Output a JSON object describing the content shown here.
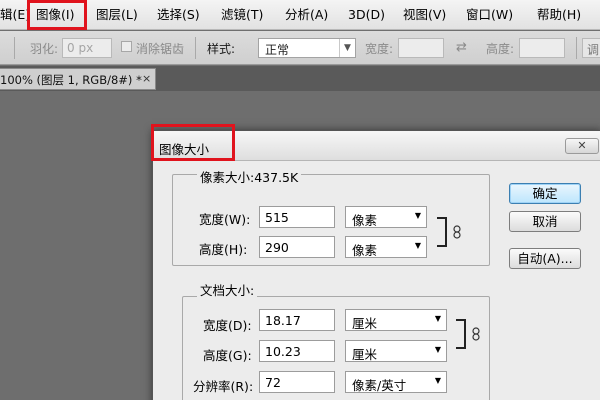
{
  "menu": {
    "items": [
      {
        "label": "辑(E)"
      },
      {
        "label": "图像(I)"
      },
      {
        "label": "图层(L)"
      },
      {
        "label": "选择(S)"
      },
      {
        "label": "滤镜(T)"
      },
      {
        "label": "分析(A)"
      },
      {
        "label": "3D(D)"
      },
      {
        "label": "视图(V)"
      },
      {
        "label": "窗口(W)"
      },
      {
        "label": "帮助(H)"
      }
    ]
  },
  "options_bar": {
    "feather_label": "羽化:",
    "feather_value": "0 px",
    "antialias_label": "消除锯齿",
    "style_label": "样式:",
    "style_value": "正常",
    "width_label": "宽度:",
    "height_label": "高度:",
    "refine_label": "调"
  },
  "document_tab": {
    "label": "100% (图层 1, RGB/8#) *",
    "close": "×"
  },
  "dialog": {
    "title": "图像大小",
    "close": "✕",
    "pixel_dimensions": {
      "label": "像素大小:437.5K",
      "width_label": "宽度(W):",
      "width_value": "515",
      "width_unit": "像素",
      "height_label": "高度(H):",
      "height_value": "290",
      "height_unit": "像素"
    },
    "document_size": {
      "label": "文档大小:",
      "width_label": "宽度(D):",
      "width_value": "18.17",
      "width_unit": "厘米",
      "height_label": "高度(G):",
      "height_value": "10.23",
      "height_unit": "厘米",
      "resolution_label": "分辨率(R):",
      "resolution_value": "72",
      "resolution_unit": "像素/英寸"
    },
    "buttons": {
      "ok": "确定",
      "cancel": "取消",
      "auto": "自动(A)..."
    }
  },
  "colors": {
    "highlight": "#e0131d",
    "workspace": "#6e6e6e",
    "dialog_bg": "#ececec",
    "default_button": "#bde6fd"
  },
  "icons": {
    "dropdown": "chevron-down-icon",
    "link": "chain-link-icon"
  }
}
